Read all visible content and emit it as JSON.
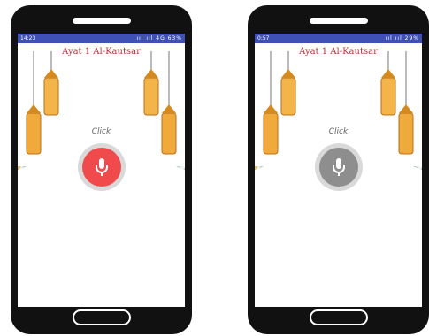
{
  "phones": [
    {
      "status": {
        "time": "14:23",
        "right": "ııl ııl 4G 63%"
      },
      "title": "Ayat 1 Al-Kautsar",
      "click_label": "Click",
      "mic": {
        "icon": "microphone-icon",
        "color": "#f04a4c",
        "state": "active"
      }
    },
    {
      "status": {
        "time": "0:57",
        "right": "ııl ııl 29%"
      },
      "title": "Ayat 1 Al-Kautsar",
      "click_label": "Click",
      "mic": {
        "icon": "microphone-icon",
        "color": "#8e8e8e",
        "state": "inactive"
      }
    }
  ]
}
